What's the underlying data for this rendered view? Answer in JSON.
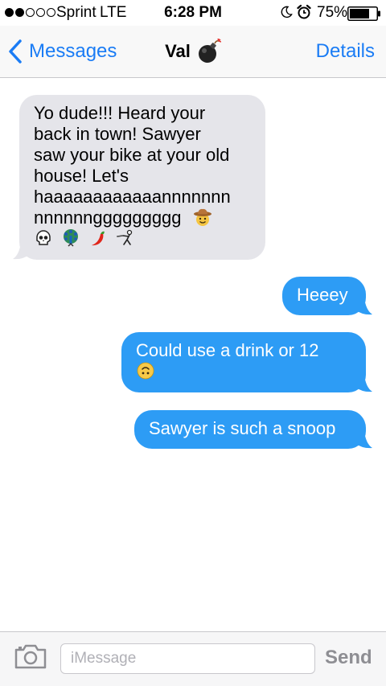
{
  "status_bar": {
    "signal_bars": 2,
    "signal_total": 5,
    "carrier": "Sprint",
    "network": "LTE",
    "time": "6:28 PM",
    "icons": [
      "moon-icon",
      "alarm-icon",
      "battery-icon"
    ],
    "battery_percent": "75%",
    "battery_level": 0.75
  },
  "nav": {
    "back_label": "Messages",
    "title": "Val",
    "title_icon": "bomb-icon",
    "details_label": "Details"
  },
  "messages": [
    {
      "direction": "incoming",
      "lines": [
        "Yo dude!!! Heard your",
        "back in town! Sawyer",
        "saw your bike at your old",
        "house! Let's",
        "haaaaaaaaaaaannnnnnn",
        "nnnnnnggggggggg"
      ],
      "emoji": [
        "cowboy-face-icon",
        "skull-icon",
        "peacock-icon",
        "hot-pepper-icon",
        "fencer-icon"
      ]
    },
    {
      "direction": "outgoing",
      "text": "Heeey"
    },
    {
      "direction": "outgoing",
      "text": "Could use a drink or 12",
      "emoji": [
        "upside-down-face-icon"
      ]
    },
    {
      "direction": "outgoing",
      "text": "Sawyer is such a snoop"
    }
  ],
  "input_bar": {
    "camera_icon": "camera-icon",
    "placeholder": "iMessage",
    "value": "",
    "send_label": "Send"
  },
  "colors": {
    "accent": "#1a7cf5",
    "outgoing_bubble": "#2d9cf5",
    "incoming_bubble": "#e5e5ea",
    "send_disabled": "#8e8e93"
  }
}
